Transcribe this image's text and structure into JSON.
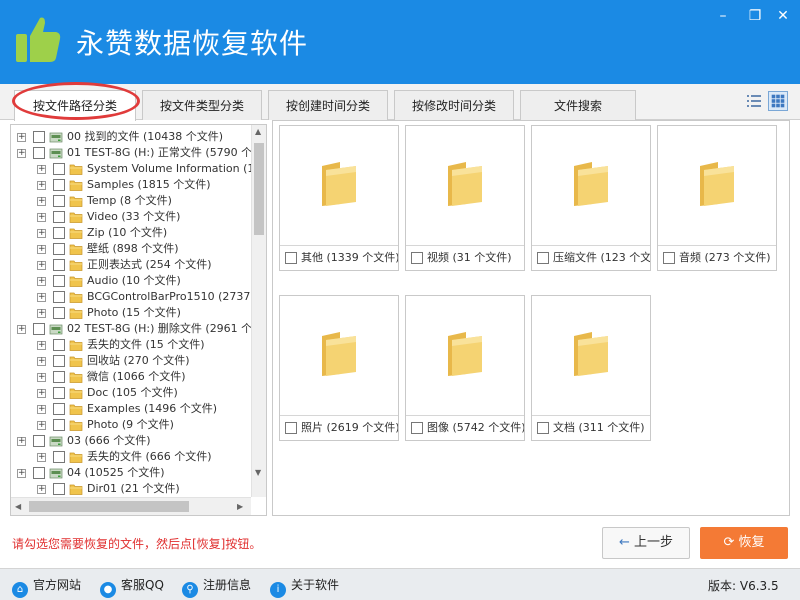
{
  "app": {
    "title": "永赞数据恢复软件"
  },
  "tabs": [
    "按文件路径分类",
    "按文件类型分类",
    "按创建时间分类",
    "按修改时间分类",
    "文件搜索"
  ],
  "tree": [
    {
      "text": "00 找到的文件  (10438 个文件)",
      "level": 0,
      "icon": "drive-icon"
    },
    {
      "text": "01 TEST-8G (H:) 正常文件 (5790 个文",
      "level": 0,
      "icon": "drive-icon"
    },
    {
      "text": "System Volume Information     (1 个",
      "level": 1,
      "icon": "folder-icon"
    },
    {
      "text": "Samples     (1815 个文件)",
      "level": 1,
      "icon": "folder-icon"
    },
    {
      "text": "Temp     (8 个文件)",
      "level": 1,
      "icon": "folder-icon"
    },
    {
      "text": "Video     (33 个文件)",
      "level": 1,
      "icon": "folder-icon"
    },
    {
      "text": "Zip     (10 个文件)",
      "level": 1,
      "icon": "folder-icon"
    },
    {
      "text": "壁纸     (898 个文件)",
      "level": 1,
      "icon": "folder-icon"
    },
    {
      "text": "正则表达式     (254 个文件)",
      "level": 1,
      "icon": "folder-icon"
    },
    {
      "text": "Audio     (10 个文件)",
      "level": 1,
      "icon": "folder-icon"
    },
    {
      "text": "BCGControlBarPro1510     (2737 个",
      "level": 1,
      "icon": "folder-icon"
    },
    {
      "text": "Photo     (15 个文件)",
      "level": 1,
      "icon": "folder-icon"
    },
    {
      "text": "02 TEST-8G (H:) 删除文件 (2961 个文",
      "level": 0,
      "icon": "drive-icon"
    },
    {
      "text": "丢失的文件     (15 个文件)",
      "level": 1,
      "icon": "folder-icon"
    },
    {
      "text": "回收站     (270 个文件)",
      "level": 1,
      "icon": "folder-icon"
    },
    {
      "text": "微信     (1066 个文件)",
      "level": 1,
      "icon": "folder-icon"
    },
    {
      "text": "Doc     (105 个文件)",
      "level": 1,
      "icon": "folder-icon"
    },
    {
      "text": "Examples     (1496 个文件)",
      "level": 1,
      "icon": "folder-icon"
    },
    {
      "text": "Photo     (9 个文件)",
      "level": 1,
      "icon": "folder-icon"
    },
    {
      "text": "03     (666 个文件)",
      "level": 0,
      "icon": "drive-icon"
    },
    {
      "text": "丢失的文件     (666 个文件)",
      "level": 1,
      "icon": "folder-icon"
    },
    {
      "text": "04     (10525 个文件)",
      "level": 0,
      "icon": "drive-icon"
    },
    {
      "text": "Dir01     (21 个文件)",
      "level": 1,
      "icon": "folder-icon"
    }
  ],
  "cards": [
    {
      "label": "其他  (1339 个文件)"
    },
    {
      "label": "视频  (31 个文件)"
    },
    {
      "label": "压缩文件  (123 个文件)"
    },
    {
      "label": "音频  (273 个文件)"
    },
    {
      "label": "照片  (2619 个文件)"
    },
    {
      "label": "图像  (5742 个文件)"
    },
    {
      "label": "文档  (311 个文件)"
    }
  ],
  "hint": "请勾选您需要恢复的文件，然后点[恢复]按钮。",
  "buttons": {
    "prev": "上一步",
    "recover": "恢复"
  },
  "footer": {
    "links": [
      "官方网站",
      "客服QQ",
      "注册信息",
      "关于软件"
    ],
    "version": "版本: V6.3.5"
  },
  "colors": {
    "titlebar": "#1b8ae4",
    "accent": "#f47a35",
    "hint": "#e03030"
  }
}
